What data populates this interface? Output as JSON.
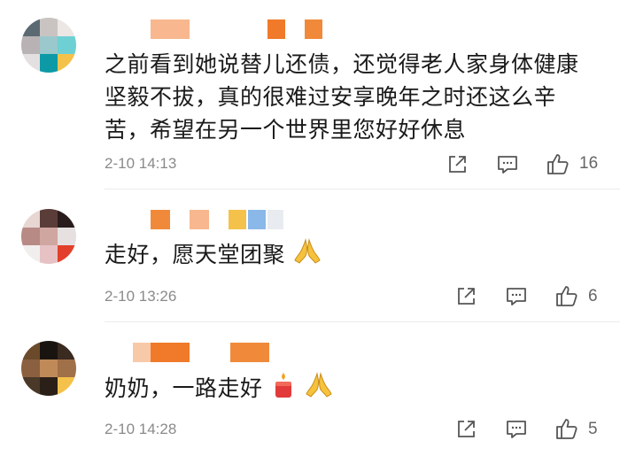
{
  "comments": [
    {
      "text": "之前看到她说替儿还债，还觉得老人家身体健康坚毅不拔，真的很难过安享晚年之时还这么辛苦，希望在另一个世界里您好好休息",
      "line1": "之前看到她说替儿还债，还觉得老人家身体健康",
      "line2": "坚毅不拔，真的很难过安享晚年之时还这么辛",
      "line3": "苦，希望在另一个世界里您好好休息",
      "time": "2-10 14:13",
      "likes": "16"
    },
    {
      "text": "走好，愿天堂团聚",
      "time": "2-10 13:26",
      "likes": "6"
    },
    {
      "text": "奶奶，一路走好",
      "time": "2-10 14:28",
      "likes": "5"
    }
  ],
  "icons": {
    "share": "share-icon",
    "comment": "comment-icon",
    "like": "thumbs-up-icon",
    "pray": "praying-hands-emoji",
    "candle": "candle-emoji"
  },
  "colors": {
    "text": "#1a1a1a",
    "meta": "#8a8a8a",
    "icon": "#555555",
    "divider": "#ebebeb",
    "mosaic_orange": "#f07a2a",
    "mosaic_peach": "#f8c9a8"
  }
}
